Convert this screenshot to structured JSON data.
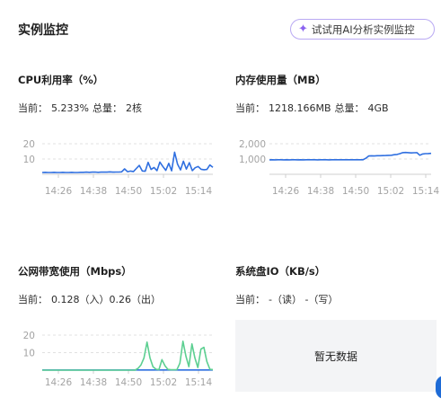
{
  "header": {
    "title": "实例监控",
    "ai_button_label": "试试用AI分析实例监控"
  },
  "colors": {
    "blue": "#2f6fe0",
    "green": "#5ccf91",
    "grid": "#e1e1e1"
  },
  "cards": {
    "cpu": {
      "title": "CPU利用率（%）",
      "current_label": "当前：",
      "current_value": "5.233%",
      "total_label": "总量：",
      "total_value": "2核"
    },
    "mem": {
      "title": "内存使用量（MB）",
      "current_label": "当前：",
      "current_value": "1218.166MB",
      "total_label": "总量：",
      "total_value": "4GB"
    },
    "net": {
      "title": "公网带宽使用（Mbps）",
      "current_label": "当前：",
      "current_value": "0.128（入）0.26（出）"
    },
    "disk": {
      "title": "系统盘IO（KB/s）",
      "current_label": "当前：",
      "current_value": "-（读） -（写）",
      "empty_text": "暂无数据"
    }
  },
  "chart_data": [
    {
      "name": "cpu",
      "type": "line",
      "x_ticks": [
        "14:26",
        "14:38",
        "14:50",
        "15:02",
        "15:14"
      ],
      "y_ticks": [
        "10",
        "20"
      ],
      "ylim": [
        0,
        20
      ],
      "series": [
        {
          "color": "#2f6fe0",
          "values": [
            1.2,
            1.3,
            1.2,
            1.2,
            1.3,
            1.2,
            1.2,
            1.3,
            1.2,
            1.2,
            1.3,
            1.2,
            1.2,
            1.3,
            1.3,
            1.4,
            1.3,
            1.4,
            1.5,
            1.3,
            1.4,
            1.5,
            1.4,
            1.6,
            1.4,
            1.5,
            1.5,
            1.6,
            3.5,
            1.7,
            2.1,
            1.8,
            3.8,
            5.8,
            2.2,
            2.0,
            7.8,
            3.2,
            4.5,
            2.4,
            8.0,
            5.1,
            2.6,
            7.2,
            2.3,
            14.5,
            6.6,
            2.9,
            8.6,
            3.4,
            7.6,
            2.4,
            4.3,
            5.1,
            3.3,
            3.0,
            3.2,
            6.1,
            4.6
          ]
        }
      ]
    },
    {
      "name": "mem",
      "type": "line",
      "x_ticks": [
        "14:26",
        "14:38",
        "14:50",
        "15:02",
        "15:14"
      ],
      "y_ticks": [
        "1,000",
        "2,000"
      ],
      "ylim": [
        0,
        2000
      ],
      "series": [
        {
          "color": "#2f6fe0",
          "values": [
            950,
            952,
            950,
            951,
            952,
            950,
            951,
            950,
            952,
            951,
            950,
            951,
            950,
            952,
            951,
            951,
            952,
            950,
            951,
            952,
            951,
            950,
            951,
            952,
            952,
            953,
            951,
            952,
            953,
            952,
            952,
            953,
            952,
            953,
            1050,
            1200,
            1210,
            1200,
            1215,
            1220,
            1225,
            1230,
            1240,
            1250,
            1280,
            1300,
            1350,
            1420,
            1430,
            1420,
            1400,
            1410,
            1420,
            1250,
            1330,
            1350,
            1360,
            1370
          ]
        }
      ]
    },
    {
      "name": "net",
      "type": "line",
      "x_ticks": [
        "14:26",
        "14:38",
        "14:50",
        "15:02",
        "15:14"
      ],
      "y_ticks": [
        "10",
        "20"
      ],
      "ylim": [
        0,
        20
      ],
      "series": [
        {
          "color": "#2f6fe0",
          "values": [
            0.1,
            0.1,
            0.1,
            0.1,
            0.1,
            0.1,
            0.1,
            0.1,
            0.1,
            0.1,
            0.1,
            0.1,
            0.1,
            0.1,
            0.1,
            0.1,
            0.1,
            0.1,
            0.1,
            0.1,
            0.1,
            0.1,
            0.1,
            0.1,
            0.1,
            0.1,
            0.1,
            0.1,
            0.1,
            0.1,
            0.1,
            0.1,
            0.1,
            0.1,
            0.1,
            0.1,
            0.1,
            0.1,
            0.1,
            0.1,
            0.1,
            0.1,
            0.1,
            0.1,
            0.1,
            0.1,
            0.1,
            0.1,
            0.1,
            0.1,
            0.1,
            0.1,
            0.1,
            0.1,
            0.1,
            0.1,
            0.1,
            0.1
          ]
        },
        {
          "color": "#5ccf91",
          "values": [
            0,
            0,
            0,
            0,
            0,
            0,
            0,
            0,
            0,
            0,
            0,
            0,
            0,
            0,
            0,
            0,
            0,
            0,
            0,
            0,
            0,
            0,
            0,
            0,
            0,
            0,
            0,
            0,
            0,
            0,
            0,
            0,
            1,
            3,
            7,
            16,
            7,
            2,
            0.5,
            0.3,
            6,
            2.5,
            0.4,
            0.2,
            0.2,
            0.3,
            4,
            16.5,
            8,
            2,
            15,
            7,
            1.5,
            12,
            13,
            5,
            0.5,
            0.3
          ]
        }
      ]
    }
  ]
}
